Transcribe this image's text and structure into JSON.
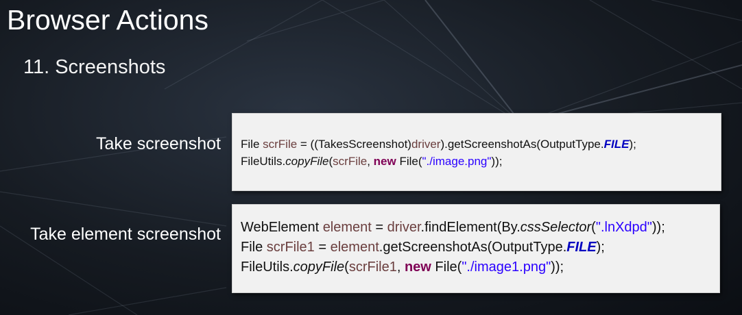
{
  "slide": {
    "title": "Browser Actions",
    "subtitle": "11. Screenshots"
  },
  "sections": [
    {
      "label": "Take screenshot",
      "code": {
        "line1": {
          "a": "File ",
          "b": "scrFile",
          "c": " = ((TakesScreenshot)",
          "d": "driver",
          "e": ").getScreenshotAs(OutputType.",
          "f": "FILE",
          "g": ");"
        },
        "line2": {
          "a": "FileUtils.",
          "b": "copyFile",
          "c": "(",
          "d": "scrFile",
          "e": ", ",
          "f": "new",
          "g": " File(",
          "h": "\"./image.png\"",
          "i": "));"
        }
      }
    },
    {
      "label": "Take element screenshot",
      "code": {
        "line1": {
          "a": "WebElement ",
          "b": "element",
          "c": " = ",
          "d": "driver",
          "e": ".findElement(By.",
          "f": "cssSelector",
          "g": "(",
          "h": "\".lnXdpd\"",
          "i": "));"
        },
        "line2": {
          "a": "File ",
          "b": "scrFile1",
          "c": " = ",
          "d": "element",
          "e": ".getScreenshotAs(OutputType.",
          "f": "FILE",
          "g": ");"
        },
        "line3": {
          "a": "FileUtils.",
          "b": "copyFile",
          "c": "(",
          "d": "scrFile1",
          "e": ", ",
          "f": "new",
          "g": " File(",
          "h": "\"./image1.png\"",
          "i": "));"
        }
      }
    }
  ],
  "colors": {
    "variable": "#6a3e3e",
    "string": "#2a00ff",
    "keyword": "#7f0055",
    "constant": "#0000c0"
  }
}
